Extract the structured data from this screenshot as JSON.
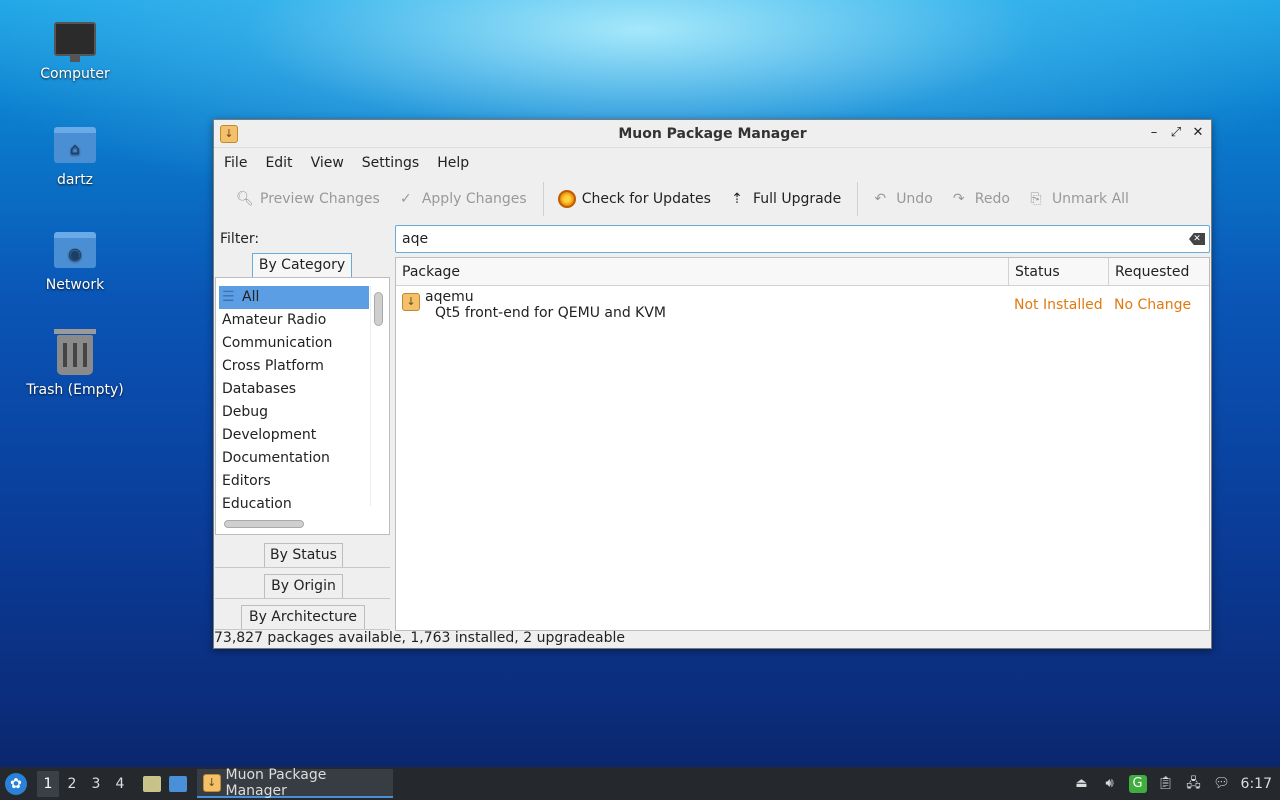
{
  "desktop": {
    "icons": [
      {
        "label": "Computer",
        "icon": "computer-icon"
      },
      {
        "label": "dartz",
        "icon": "home-folder-icon"
      },
      {
        "label": "Network",
        "icon": "network-folder-icon"
      },
      {
        "label": "Trash (Empty)",
        "icon": "trash-icon"
      }
    ]
  },
  "window": {
    "title": "Muon Package Manager",
    "menu": [
      "File",
      "Edit",
      "View",
      "Settings",
      "Help"
    ],
    "toolbar": {
      "preview_changes": "Preview Changes",
      "apply_changes": "Apply Changes",
      "check_updates": "Check for Updates",
      "full_upgrade": "Full Upgrade",
      "undo": "Undo",
      "redo": "Redo",
      "unmark_all": "Unmark All"
    },
    "filter": {
      "label": "Filter:",
      "tabs": {
        "by_category": "By Category",
        "by_status": "By Status",
        "by_origin": "By Origin",
        "by_architecture": "By Architecture"
      },
      "categories": [
        "All",
        "Amateur Radio",
        "Communication",
        "Cross Platform",
        "Databases",
        "Debug",
        "Development",
        "Documentation",
        "Editors",
        "Education"
      ],
      "selected_category": "All"
    },
    "search": {
      "value": "aqe"
    },
    "table": {
      "columns": [
        "Package",
        "Status",
        "Requested"
      ],
      "rows": [
        {
          "name": "aqemu",
          "description": "Qt5 front-end for QEMU and KVM",
          "status": "Not Installed",
          "requested": "No Change"
        }
      ]
    },
    "statusbar": "73,827 packages available, 1,763 installed, 2 upgradeable"
  },
  "taskbar": {
    "workspaces": [
      "1",
      "2",
      "3",
      "4"
    ],
    "current_workspace": "1",
    "task": "Muon Package Manager",
    "clock": "6:17"
  },
  "colors": {
    "accent": "#5c9ee3",
    "status_text": "#e07a10"
  }
}
